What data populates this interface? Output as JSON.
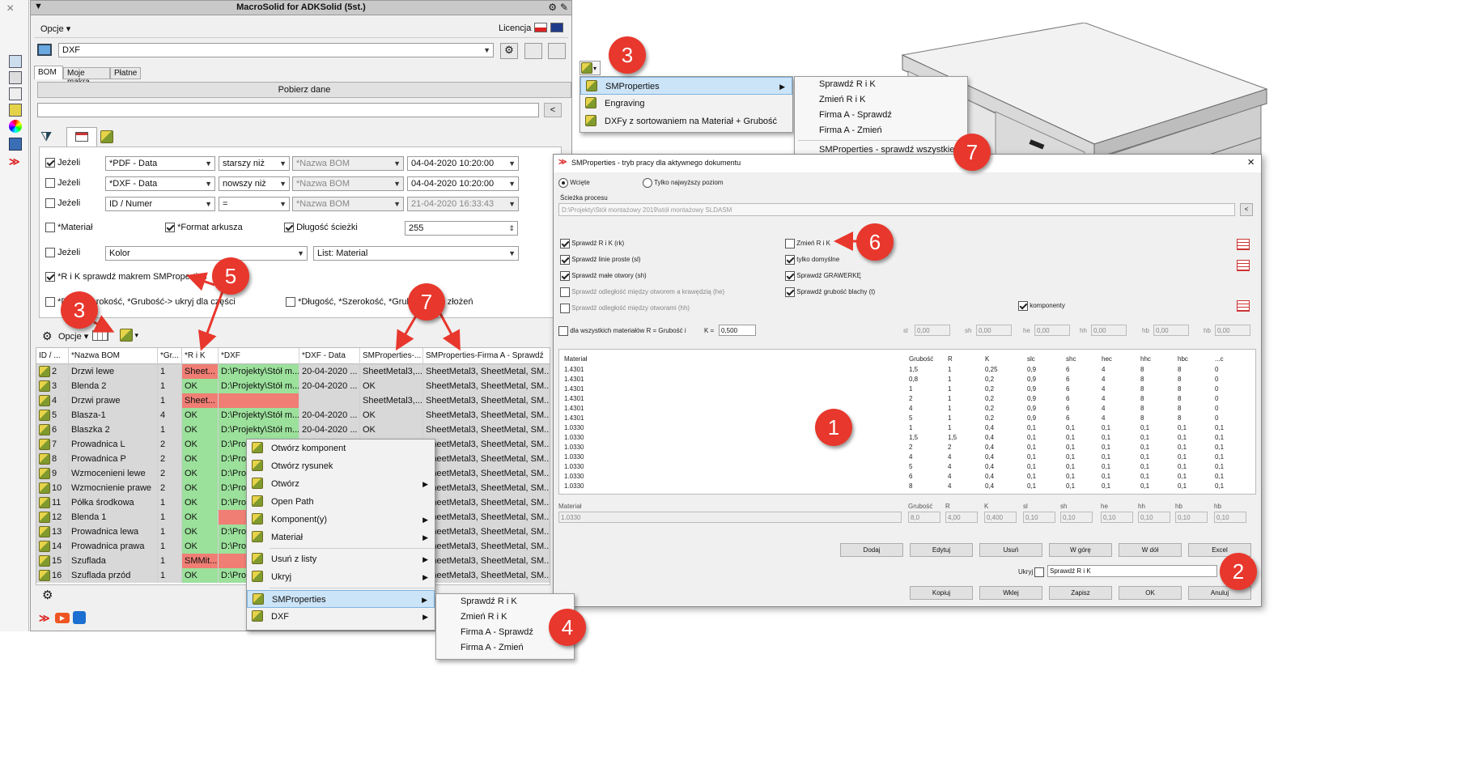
{
  "left_toolbar": {
    "close": "×"
  },
  "main": {
    "title": "MacroSolid for ADKSolid (5st.)",
    "options_label": "Opcje ▾",
    "license_label": "Licencja",
    "format_value": "DXF",
    "tabs": [
      "BOM",
      "Moje makra",
      "Płatne"
    ],
    "fetch_button": "Pobierz dane",
    "back_button": "<",
    "filters": [
      {
        "checked": true,
        "label": "Jeżeli",
        "field": "*PDF - Data",
        "op": "starszy niż",
        "ref": "*Nazwa BOM",
        "date": "04-04-2020 10:20:00"
      },
      {
        "checked": false,
        "label": "Jeżeli",
        "field": "*DXF - Data",
        "op": "nowszy niż",
        "ref": "*Nazwa BOM",
        "date": "04-04-2020 10:20:00"
      },
      {
        "checked": false,
        "label": "Jeżeli",
        "field": "ID / Numer",
        "op": "=",
        "ref": "*Nazwa BOM",
        "date": "21-04-2020 16:33:43"
      }
    ],
    "opt_material": "*Materiał",
    "opt_format": "*Format arkusza",
    "opt_length": "Długość ścieżki",
    "opt_length_value": "255",
    "color_label": "Jeżeli",
    "color_field": "Kolor",
    "color_list": "List: Material",
    "rik_label": "*R i K sprawdź makrem SMProperties",
    "hide_parts_label": "*D...,*Szerokość, *Grubość-> ukryj dla części",
    "hide_asm_label": "*Długość, *Szerokość, *Grubość...dla złożeń",
    "grid_toolbar_options": "Opcje ▾",
    "columns": [
      "ID / ...",
      "*Nazwa BOM",
      "*Gr...",
      "*R i K",
      "*DXF",
      "*DXF - Data",
      "SMProperties-...",
      "SMProperties-Firma A - Sprawdź"
    ],
    "rows": [
      {
        "id": "2",
        "name": "Drzwi lewe",
        "gr": "1",
        "rik": "Sheet...",
        "rikc": "red",
        "dxf": "D:\\Projekty\\Stół m...",
        "dxfc": "green",
        "date": "20-04-2020 ...",
        "smp": "SheetMetal3,...",
        "firma": "SheetMetal3, SheetMetal, SM..."
      },
      {
        "id": "3",
        "name": "Blenda 2",
        "gr": "1",
        "rik": "OK",
        "rikc": "green",
        "dxf": "D:\\Projekty\\Stół m...",
        "dxfc": "green",
        "date": "20-04-2020 ...",
        "smp": "OK",
        "firma": "SheetMetal3, SheetMetal, SM..."
      },
      {
        "id": "4",
        "name": "Drzwi prawe",
        "gr": "1",
        "rik": "Sheet...",
        "rikc": "red",
        "dxf": "",
        "dxfc": "red",
        "date": "",
        "smp": "SheetMetal3,...",
        "firma": "SheetMetal3, SheetMetal, SM..."
      },
      {
        "id": "5",
        "name": "Blasza-1",
        "gr": "4",
        "rik": "OK",
        "rikc": "green",
        "dxf": "D:\\Projekty\\Stół m...",
        "dxfc": "green",
        "date": "20-04-2020 ...",
        "smp": "OK",
        "firma": "SheetMetal3, SheetMetal, SM..."
      },
      {
        "id": "6",
        "name": "Blaszka 2",
        "gr": "1",
        "rik": "OK",
        "rikc": "green",
        "dxf": "D:\\Projekty\\Stół m...",
        "dxfc": "green",
        "date": "20-04-2020 ...",
        "smp": "OK",
        "firma": "SheetMetal3, SheetMetal, SM..."
      },
      {
        "id": "7",
        "name": "Prowadnica L",
        "gr": "2",
        "rik": "OK",
        "rikc": "green",
        "dxf": "D:\\Pro",
        "dxfc": "green",
        "date": "",
        "smp": "",
        "firma": "SheetMetal3, SheetMetal, SM..."
      },
      {
        "id": "8",
        "name": "Prowadnica P",
        "gr": "2",
        "rik": "OK",
        "rikc": "green",
        "dxf": "D:\\Pro",
        "dxfc": "green",
        "date": "",
        "smp": "",
        "firma": "SheetMetal3, SheetMetal, SM..."
      },
      {
        "id": "9",
        "name": "Wzmocenieni lewe",
        "gr": "2",
        "rik": "OK",
        "rikc": "green",
        "dxf": "D:\\Pro",
        "dxfc": "green",
        "date": "",
        "smp": "",
        "firma": "SheetMetal3, SheetMetal, SM..."
      },
      {
        "id": "10",
        "name": "Wzmocnienie prawe",
        "gr": "2",
        "rik": "OK",
        "rikc": "green",
        "dxf": "D:\\Pro",
        "dxfc": "green",
        "date": "",
        "smp": "",
        "firma": "SheetMetal3, SheetMetal, SM..."
      },
      {
        "id": "11",
        "name": "Półka środkowa",
        "gr": "1",
        "rik": "OK",
        "rikc": "green",
        "dxf": "D:\\Pro",
        "dxfc": "green",
        "date": "",
        "smp": "",
        "firma": "SheetMetal3, SheetMetal, SM..."
      },
      {
        "id": "12",
        "name": "Blenda 1",
        "gr": "1",
        "rik": "OK",
        "rikc": "green",
        "dxf": "",
        "dxfc": "red",
        "date": "",
        "smp": "",
        "firma": "SheetMetal3, SheetMetal, SM..."
      },
      {
        "id": "13",
        "name": "Prowadnica lewa",
        "gr": "1",
        "rik": "OK",
        "rikc": "green",
        "dxf": "D:\\Pro",
        "dxfc": "green",
        "date": "",
        "smp": "",
        "firma": "SheetMetal3, SheetMetal, SM..."
      },
      {
        "id": "14",
        "name": "Prowadnica prawa",
        "gr": "1",
        "rik": "OK",
        "rikc": "green",
        "dxf": "D:\\Pro",
        "dxfc": "green",
        "date": "",
        "smp": "",
        "firma": "SheetMetal3, SheetMetal, SM..."
      },
      {
        "id": "15",
        "name": "Szuflada",
        "gr": "1",
        "rik": "SMMit...",
        "rikc": "red",
        "dxf": "",
        "dxfc": "red",
        "date": "",
        "smp": "",
        "firma": "SheetMetal3, SheetMetal, SM..."
      },
      {
        "id": "16",
        "name": "Szuflada przód",
        "gr": "1",
        "rik": "OK",
        "rikc": "green",
        "dxf": "D:\\Pro",
        "dxfc": "green",
        "date": "",
        "smp": "",
        "firma": "SheetMetal3, SheetMetal, SM..."
      }
    ]
  },
  "context_menu": {
    "items": [
      "Otwórz komponent",
      "Otwórz rysunek",
      "Otwórz",
      "Open Path",
      "Komponent(y)",
      "Materiał",
      "Usuń z listy",
      "Ukryj",
      "SMProperties",
      "DXF"
    ],
    "submenu": [
      "Sprawdź R i K",
      "Zmień R i K",
      "Firma A - Sprawdź",
      "Firma A - Zmień"
    ]
  },
  "top_menu": {
    "items": [
      "SMProperties",
      "Engraving",
      "DXFy z sortowaniem na Materiał + Grubość"
    ],
    "submenu": [
      "Sprawdź R i K",
      "Zmień R i K",
      "Firma A - Sprawdź",
      "Firma A - Zmień",
      "SMProperties - sprawdź wszystkie"
    ]
  },
  "dialog": {
    "title": "SMProperties - tryb pracy dla aktywnego dokumentu",
    "close": "×",
    "radio1": "Wcięte",
    "radio2": "Tylko najwyższy poziom",
    "path_label": "Ścieżka procesu",
    "path_value": "D:\\Projekty\\Stół montażowy 2019\\stół montażowy SLDASM",
    "left_checks": [
      {
        "on": true,
        "label": "Sprawdź R i K (rk)"
      },
      {
        "on": true,
        "label": "Sprawdź linie proste (sl)"
      },
      {
        "on": true,
        "label": "Sprawdź małe otwory (sh)"
      },
      {
        "on": false,
        "label": "Sprawdź odległość między otworem a krawędzią (he)"
      },
      {
        "on": false,
        "label": "Sprawdź odległość między otworami (hh)"
      }
    ],
    "mid_checks": [
      {
        "on": false,
        "label": "Zmień R i K"
      },
      {
        "on": true,
        "label": "tylko domyślne"
      },
      {
        "on": true,
        "label": "Sprawdź GRAWERKĘ"
      },
      {
        "on": true,
        "label": "Sprawdź grubość blachy (t)"
      }
    ],
    "komponenty": "komponenty",
    "all_materials": "dla wszystkich materiałów R = Grubość i",
    "k_label": "K =",
    "k_value": "0,500",
    "param_labels": [
      "sl",
      "sh",
      "he",
      "hh",
      "hb",
      "hb"
    ],
    "param_value": "0,00",
    "table_headers": [
      "Materiał",
      "Grubość",
      "R",
      "K",
      "slc",
      "shc",
      "hec",
      "hhc",
      "hbc",
      "...c"
    ],
    "table_rows": [
      [
        "1.4301",
        "1,5",
        "1",
        "0,25",
        "0,9",
        "6",
        "4",
        "8",
        "8",
        "0"
      ],
      [
        "1.4301",
        "0,8",
        "1",
        "0,2",
        "0,9",
        "6",
        "4",
        "8",
        "8",
        "0"
      ],
      [
        "1.4301",
        "1",
        "1",
        "0,2",
        "0,9",
        "6",
        "4",
        "8",
        "8",
        "0"
      ],
      [
        "1.4301",
        "2",
        "1",
        "0,2",
        "0,9",
        "6",
        "4",
        "8",
        "8",
        "0"
      ],
      [
        "1.4301",
        "4",
        "1",
        "0,2",
        "0,9",
        "6",
        "4",
        "8",
        "8",
        "0"
      ],
      [
        "1.4301",
        "5",
        "1",
        "0,2",
        "0,9",
        "6",
        "4",
        "8",
        "8",
        "0"
      ],
      [
        "1.0330",
        "1",
        "1",
        "0,4",
        "0,1",
        "0,1",
        "0,1",
        "0,1",
        "0,1",
        "0,1"
      ],
      [
        "1.0330",
        "1,5",
        "1,5",
        "0,4",
        "0,1",
        "0,1",
        "0,1",
        "0,1",
        "0,1",
        "0,1"
      ],
      [
        "1.0330",
        "2",
        "2",
        "0,4",
        "0,1",
        "0,1",
        "0,1",
        "0,1",
        "0,1",
        "0,1"
      ],
      [
        "1.0330",
        "4",
        "4",
        "0,4",
        "0,1",
        "0,1",
        "0,1",
        "0,1",
        "0,1",
        "0,1"
      ],
      [
        "1.0330",
        "5",
        "4",
        "0,4",
        "0,1",
        "0,1",
        "0,1",
        "0,1",
        "0,1",
        "0,1"
      ],
      [
        "1.0330",
        "6",
        "4",
        "0,4",
        "0,1",
        "0,1",
        "0,1",
        "0,1",
        "0,1",
        "0,1"
      ],
      [
        "1.0330",
        "8",
        "4",
        "0,4",
        "0,1",
        "0,1",
        "0,1",
        "0,1",
        "0,1",
        "0,1"
      ]
    ],
    "edit_labels": [
      "Materiał",
      "Grubość",
      "R",
      "K",
      "sl",
      "sh",
      "he",
      "hh",
      "hb",
      "hb"
    ],
    "edit_values": [
      "1.0330",
      "8,0",
      "4,00",
      "0,400",
      "0,10",
      "0,10",
      "0,10",
      "0,10",
      "0,10",
      "0,10"
    ],
    "buttons_row1": [
      "Dodaj",
      "Edytuj",
      "Usuń",
      "W górę",
      "W dół",
      "Excel"
    ],
    "hide_label": "Ukryj",
    "hide_value": "Sprawdź R i K",
    "buttons_row2": [
      "Kopiuj",
      "Wklej",
      "Zapisz",
      "OK",
      "Anuluj"
    ]
  },
  "badges": {
    "b1": "1",
    "b2": "2",
    "b3a": "3",
    "b3b": "3",
    "b4": "4",
    "b5": "5",
    "b6": "6",
    "b7a": "7",
    "b7b": "7"
  },
  "colors": {
    "badge": "#e8372c",
    "ok_green": "#9be09b",
    "err_red": "#f07e74",
    "highlight": "#cce4f7"
  }
}
